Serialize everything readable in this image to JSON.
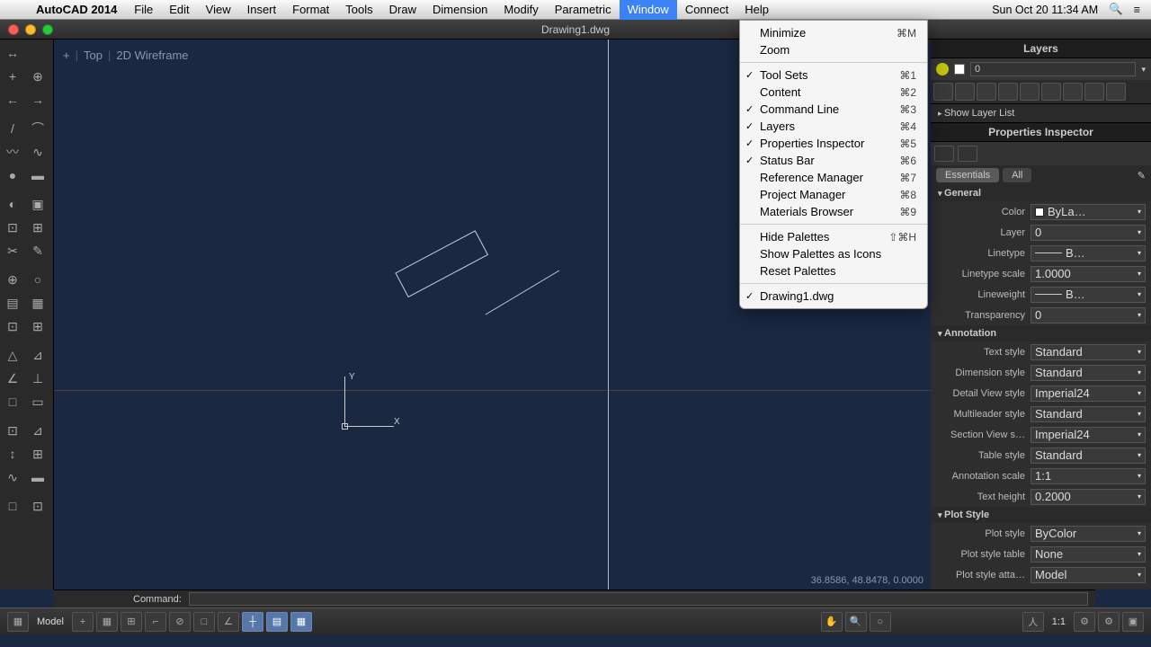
{
  "menubar": {
    "app": "AutoCAD 2014",
    "items": [
      "File",
      "Edit",
      "View",
      "Insert",
      "Format",
      "Tools",
      "Draw",
      "Dimension",
      "Modify",
      "Parametric",
      "Window",
      "Connect",
      "Help"
    ],
    "active_index": 10,
    "clock": "Sun Oct 20  11:34 AM"
  },
  "dropdown": {
    "groups": [
      [
        {
          "label": "Minimize",
          "shortcut": "⌘M",
          "checked": false
        },
        {
          "label": "Zoom",
          "shortcut": "",
          "checked": false
        }
      ],
      [
        {
          "label": "Tool Sets",
          "shortcut": "⌘1",
          "checked": true
        },
        {
          "label": "Content",
          "shortcut": "⌘2",
          "checked": false
        },
        {
          "label": "Command Line",
          "shortcut": "⌘3",
          "checked": true
        },
        {
          "label": "Layers",
          "shortcut": "⌘4",
          "checked": true
        },
        {
          "label": "Properties Inspector",
          "shortcut": "⌘5",
          "checked": true
        },
        {
          "label": "Status Bar",
          "shortcut": "⌘6",
          "checked": true
        },
        {
          "label": "Reference Manager",
          "shortcut": "⌘7",
          "checked": false
        },
        {
          "label": "Project Manager",
          "shortcut": "⌘8",
          "checked": false
        },
        {
          "label": "Materials Browser",
          "shortcut": "⌘9",
          "checked": false
        }
      ],
      [
        {
          "label": "Hide Palettes",
          "shortcut": "⇧⌘H",
          "checked": false
        },
        {
          "label": "Show Palettes as Icons",
          "shortcut": "",
          "checked": false
        },
        {
          "label": "Reset Palettes",
          "shortcut": "",
          "checked": false
        }
      ],
      [
        {
          "label": "Drawing1.dwg",
          "shortcut": "",
          "checked": true
        }
      ]
    ]
  },
  "titlebar": {
    "title": "Drawing1.dwg"
  },
  "viewport": {
    "view": "Top",
    "style": "2D Wireframe"
  },
  "coords": "36.8586, 48.8478, 0.0000",
  "layers_panel": {
    "title": "Layers",
    "current": "0",
    "show_list": "Show Layer List"
  },
  "props": {
    "title": "Properties Inspector",
    "tabs": {
      "essentials": "Essentials",
      "all": "All"
    },
    "sections": {
      "general": "General",
      "annotation": "Annotation",
      "plot": "Plot Style"
    },
    "general": {
      "color_label": "Color",
      "color_value": "ByLa…",
      "layer_label": "Layer",
      "layer_value": "0",
      "linetype_label": "Linetype",
      "linetype_value": "B…",
      "ltscale_label": "Linetype scale",
      "ltscale_value": "1.0000",
      "lw_label": "Lineweight",
      "lw_value": "B…",
      "trans_label": "Transparency",
      "trans_value": "0"
    },
    "annotation": {
      "textstyle_label": "Text style",
      "textstyle_value": "Standard",
      "dimstyle_label": "Dimension style",
      "dimstyle_value": "Standard",
      "detail_label": "Detail View style",
      "detail_value": "Imperial24",
      "mleader_label": "Multileader style",
      "mleader_value": "Standard",
      "section_label": "Section View s…",
      "section_value": "Imperial24",
      "table_label": "Table style",
      "table_value": "Standard",
      "annoscale_label": "Annotation scale",
      "annoscale_value": "1:1",
      "textheight_label": "Text height",
      "textheight_value": "0.2000"
    },
    "plot": {
      "pstyle_label": "Plot style",
      "pstyle_value": "ByColor",
      "ptable_label": "Plot style table",
      "ptable_value": "None",
      "patta_label": "Plot style atta…",
      "patta_value": "Model"
    }
  },
  "cmdline": {
    "label": "Command:"
  },
  "statusbar": {
    "model": "Model",
    "scale": "1:1"
  }
}
